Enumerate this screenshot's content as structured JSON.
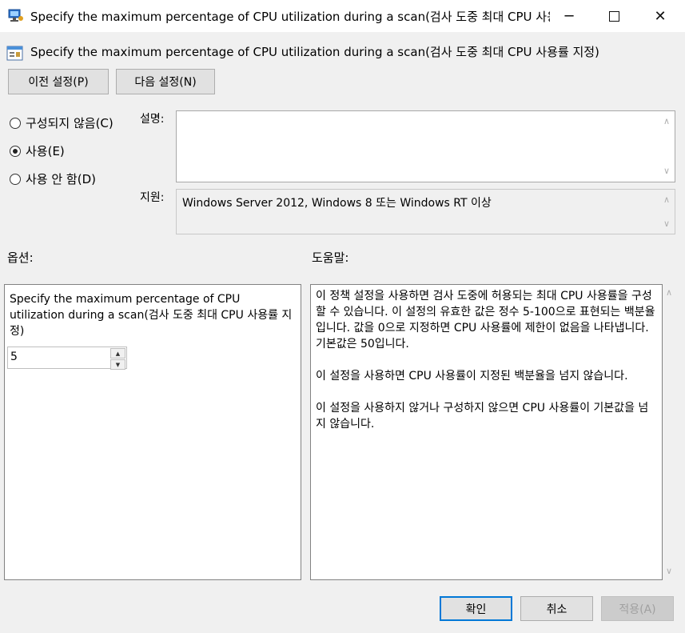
{
  "window": {
    "title": "Specify the maximum percentage of CPU utilization during a scan(검사 도중 최대 CPU 사용...",
    "minimize_icon": "minimize-icon",
    "maximize_icon": "maximize-icon",
    "close_icon": "close-icon"
  },
  "header": {
    "title": "Specify the maximum percentage of CPU utilization during a scan(검사 도중 최대 CPU 사용률 지정)"
  },
  "nav": {
    "prev_label": "이전 설정(P)",
    "next_label": "다음 설정(N)"
  },
  "state": {
    "options": [
      {
        "label": "구성되지 않음(C)",
        "checked": false
      },
      {
        "label": "사용(E)",
        "checked": true
      },
      {
        "label": "사용 안 함(D)",
        "checked": false
      }
    ]
  },
  "info": {
    "comment_label": "설명:",
    "comment_value": "",
    "supported_label": "지원:",
    "supported_value": "Windows Server 2012, Windows 8 또는 Windows RT 이상"
  },
  "sections": {
    "options_label": "옵션:",
    "help_label": "도움말:"
  },
  "options_panel": {
    "description": "Specify the maximum percentage of CPU utilization during a scan(검사 도중 최대 CPU 사용률 지정)",
    "value": "5"
  },
  "help": {
    "paragraphs": [
      "이 정책 설정을 사용하면 검사 도중에 허용되는 최대 CPU 사용률을 구성할 수 있습니다. 이 설정의 유효한 값은 정수 5-100으로 표현되는 백분율입니다. 값을 0으로 지정하면 CPU 사용률에 제한이 없음을 나타냅니다. 기본값은 50입니다.",
      "이 설정을 사용하면 CPU 사용률이 지정된 백분율을 넘지 않습니다.",
      "이 설정을 사용하지 않거나 구성하지 않으면 CPU 사용률이 기본값을 넘지 않습니다."
    ]
  },
  "footer": {
    "ok_label": "확인",
    "cancel_label": "취소",
    "apply_label": "적용(A)"
  },
  "colors": {
    "accent": "#0078d7",
    "dialog_bg": "#f0f0f0"
  }
}
